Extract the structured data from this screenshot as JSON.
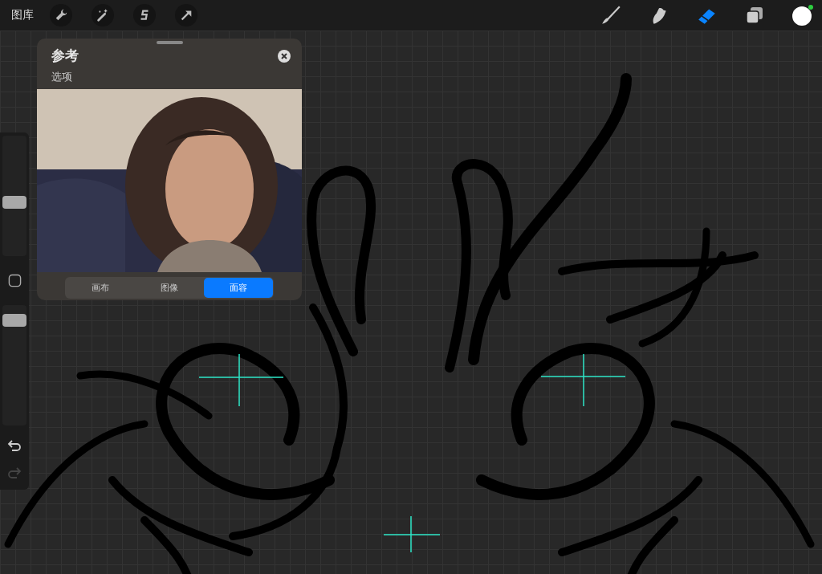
{
  "top_bar": {
    "gallery": "图库",
    "actions": [
      {
        "kind": "wrench"
      },
      {
        "kind": "wand"
      },
      {
        "kind": "select"
      },
      {
        "kind": "move"
      }
    ],
    "tools": [
      {
        "kind": "brush",
        "selected": false
      },
      {
        "kind": "smudge",
        "selected": false
      },
      {
        "kind": "eraser",
        "selected": true
      },
      {
        "kind": "layers",
        "selected": false
      }
    ]
  },
  "sidebar": {
    "size_slider": {
      "level": 0.44
    },
    "opacity_slider": {
      "level": 0.92
    },
    "undo": {
      "disabled": false
    },
    "redo": {
      "disabled": true
    }
  },
  "reference_panel": {
    "title": "参考",
    "subtitle": "选项",
    "tabs": [
      {
        "label": "画布",
        "selected": false
      },
      {
        "label": "图像",
        "selected": false
      },
      {
        "label": "面容",
        "selected": true
      }
    ]
  }
}
